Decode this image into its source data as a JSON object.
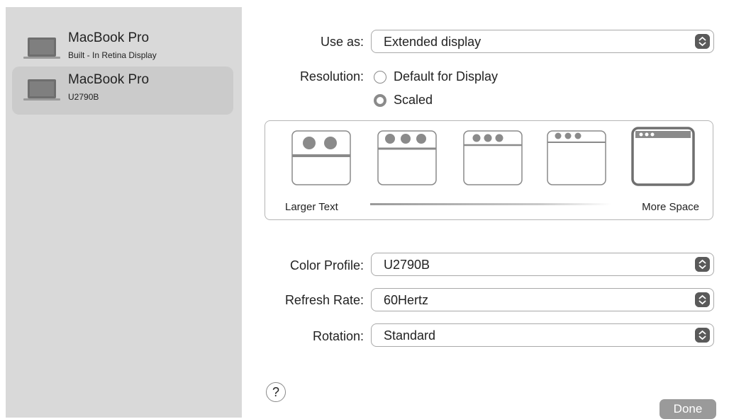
{
  "sidebar": {
    "displays": [
      {
        "name": "MacBook Pro",
        "subtitle": "Built - In Retina Display",
        "icon": "laptop-icon"
      },
      {
        "name": "MacBook Pro",
        "subtitle": "U2790B",
        "icon": "laptop-icon"
      }
    ]
  },
  "settings": {
    "use_as": {
      "label": "Use as:",
      "value": "Extended display"
    },
    "resolution": {
      "label": "Resolution:",
      "options": [
        "Default for Display",
        "Scaled"
      ],
      "selected": "Scaled"
    },
    "scale": {
      "left_label": "Larger Text",
      "right_label": "More Space"
    },
    "color_profile": {
      "label": "Color Profile:",
      "value": "U2790B"
    },
    "refresh_rate": {
      "label": "Refresh Rate:",
      "value": "60Hertz"
    },
    "rotation": {
      "label": "Rotation:",
      "value": "Standard"
    }
  },
  "footer": {
    "help_label": "?",
    "done_label": "Done"
  },
  "colors": {
    "sidebar_bg": "#d9d9d9",
    "selected_bg": "#cbcbcb",
    "done_bg": "#9a9a9a",
    "stepper_bg": "#5a5a5a"
  }
}
